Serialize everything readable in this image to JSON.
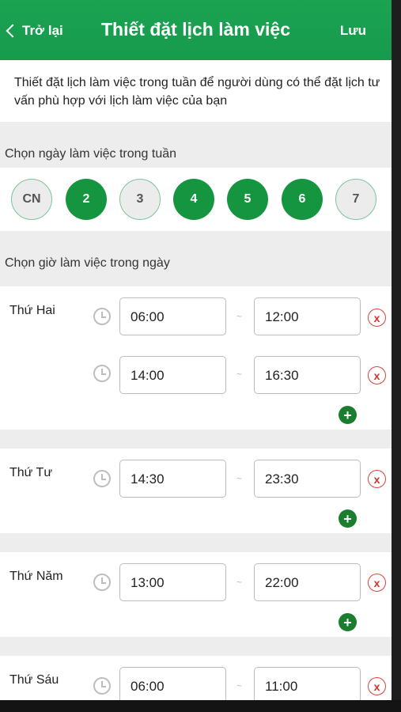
{
  "header": {
    "back_label": "Trở lại",
    "title": "Thiết đặt lịch làm việc",
    "save_label": "Lưu"
  },
  "intro": "Thiết đặt lịch làm việc trong tuần để người dùng có thể đặt lịch tư vấn phù hợp với lịch làm việc của bạn",
  "days_section": {
    "label": "Chọn ngày làm việc trong tuần",
    "days": [
      {
        "label": "CN",
        "selected": false
      },
      {
        "label": "2",
        "selected": true
      },
      {
        "label": "3",
        "selected": false
      },
      {
        "label": "4",
        "selected": true
      },
      {
        "label": "5",
        "selected": true
      },
      {
        "label": "6",
        "selected": true
      },
      {
        "label": "7",
        "selected": false
      }
    ]
  },
  "hours_section": {
    "label": "Chọn giờ làm việc trong ngày",
    "separator": "~",
    "remove_icon": "x",
    "add_icon": "+",
    "schedule": [
      {
        "day": "Thứ Hai",
        "slots": [
          {
            "from": "06:00",
            "to": "12:00"
          },
          {
            "from": "14:00",
            "to": "16:30"
          }
        ]
      },
      {
        "day": "Thứ Tư",
        "slots": [
          {
            "from": "14:30",
            "to": "23:30"
          }
        ]
      },
      {
        "day": "Thứ Năm",
        "slots": [
          {
            "from": "13:00",
            "to": "22:00"
          }
        ]
      },
      {
        "day": "Thứ Sáu",
        "slots": [
          {
            "from": "06:00",
            "to": "11:00"
          }
        ]
      }
    ]
  },
  "colors": {
    "primary": "#179a4c",
    "selected_day": "#15953f",
    "add_button": "#1b7e2f",
    "remove": "#d8312a"
  }
}
